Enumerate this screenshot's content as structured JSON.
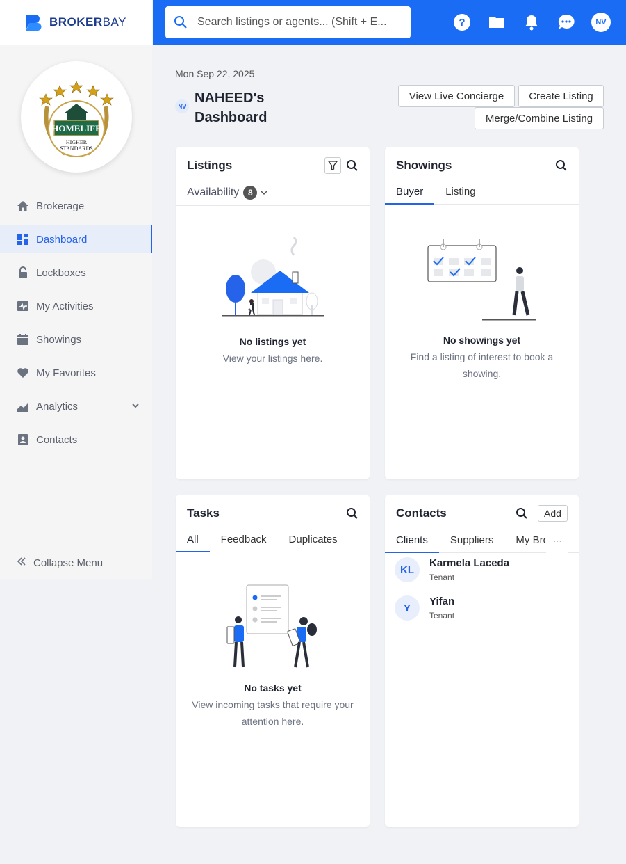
{
  "brand": {
    "name_bold": "BROKER",
    "name_light": "BAY"
  },
  "logo": {
    "line1": "HOMELIFE",
    "line2": "HIGHER",
    "line3": "STANDARDS"
  },
  "search": {
    "placeholder": "Search listings or agents... (Shift + E..."
  },
  "topbar": {
    "avatar_initials": "NV",
    "icons": [
      "help-icon",
      "folder-icon",
      "bell-icon",
      "chat-icon"
    ]
  },
  "sidebar": {
    "items": [
      {
        "label": "Brokerage",
        "icon": "home-icon"
      },
      {
        "label": "Dashboard",
        "icon": "dashboard-icon",
        "active": true
      },
      {
        "label": "Lockboxes",
        "icon": "lock-icon"
      },
      {
        "label": "My Activities",
        "icon": "activity-icon"
      },
      {
        "label": "Showings",
        "icon": "calendar-icon"
      },
      {
        "label": "My Favorites",
        "icon": "heart-icon"
      },
      {
        "label": "Analytics",
        "icon": "chart-icon"
      },
      {
        "label": "Contacts",
        "icon": "contacts-icon"
      }
    ],
    "collapse_label": "Collapse Menu"
  },
  "header": {
    "date": "Mon Sep 22, 2025",
    "avatar_initials": "NV",
    "title": "NAHEED's Dashboard",
    "buttons": {
      "concierge": "View Live Concierge",
      "create": "Create Listing",
      "merge": "Merge/Combine Listing"
    }
  },
  "listings": {
    "title": "Listings",
    "filter_label": "Availability",
    "filter_count": "8",
    "empty_title": "No listings yet",
    "empty_sub": "View your listings here."
  },
  "showings": {
    "title": "Showings",
    "tabs": [
      "Buyer",
      "Listing"
    ],
    "empty_title": "No showings yet",
    "empty_sub": "Find a listing of interest to book a showing."
  },
  "tasks": {
    "title": "Tasks",
    "tabs": [
      "All",
      "Feedback",
      "Duplicates"
    ],
    "empty_title": "No tasks yet",
    "empty_sub": "View incoming tasks that require your attention here."
  },
  "contacts": {
    "title": "Contacts",
    "add_label": "Add",
    "tabs": [
      "Clients",
      "Suppliers",
      "My Bro"
    ],
    "more_label": "···",
    "rows": [
      {
        "initials": "KL",
        "name": "Karmela Laceda",
        "role": "Tenant"
      },
      {
        "initials": "Y",
        "name": "Yifan",
        "role": "Tenant"
      }
    ]
  },
  "colors": {
    "primary": "#1a6cf5",
    "accent": "#2563eb",
    "brand_dark": "#1a3a8c"
  }
}
